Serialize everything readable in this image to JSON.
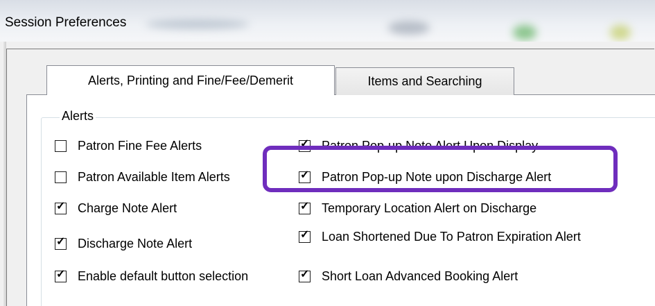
{
  "window": {
    "title": "Session Preferences"
  },
  "tabs": [
    {
      "label": "Alerts, Printing and Fine/Fee/Demerit",
      "active": true
    },
    {
      "label": "Items and Searching",
      "active": false
    }
  ],
  "alerts_group": {
    "legend": "Alerts",
    "left_column": [
      {
        "label": "Patron Fine Fee Alerts",
        "checked": false
      },
      {
        "label": "Patron Available Item Alerts",
        "checked": false
      },
      {
        "label": "Charge Note Alert",
        "checked": true
      },
      {
        "label": "Discharge Note Alert",
        "checked": true
      },
      {
        "label": "Enable default button selection",
        "checked": true
      }
    ],
    "right_column": [
      {
        "label": "Patron Pop-up Note Alert Upon Display",
        "checked": true
      },
      {
        "label": "Patron Pop-up Note upon Discharge Alert",
        "checked": true
      },
      {
        "label": "Temporary Location Alert on Discharge",
        "checked": true
      },
      {
        "label": "Loan Shortened Due To Patron Expiration Alert",
        "checked": true
      },
      {
        "label": "Short Loan Advanced Booking Alert",
        "checked": true
      }
    ]
  },
  "colors": {
    "highlight": "#6f2dbd"
  }
}
